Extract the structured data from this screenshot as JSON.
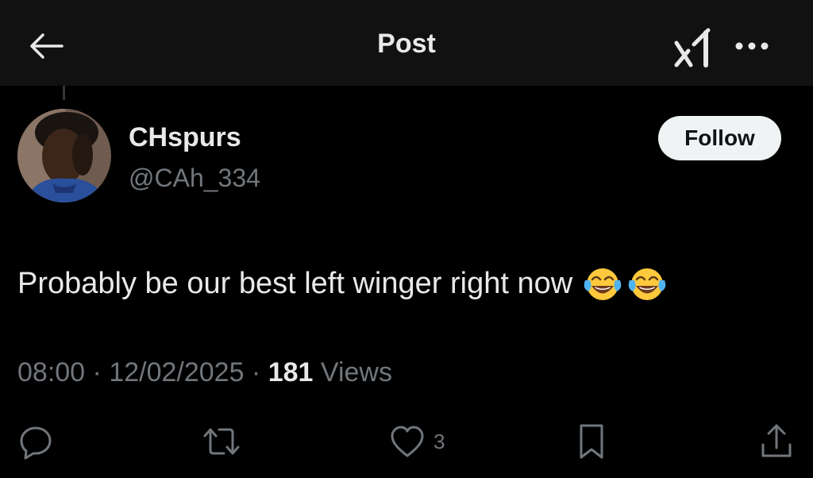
{
  "header": {
    "title": "Post",
    "back_icon": "arrow-left-icon",
    "grok_icon": "grok-icon",
    "more_icon": "more-horizontal-icon"
  },
  "author": {
    "display_name": "CHspurs",
    "handle": "@CAh_334",
    "follow_label": "Follow"
  },
  "post": {
    "text": "Probably be our best left winger right now",
    "emojis": [
      "😂",
      "😂"
    ]
  },
  "meta": {
    "time": "08:00",
    "sep1": " · ",
    "date": "12/02/2025",
    "sep2": " · ",
    "views_count": "181",
    "views_label": " Views"
  },
  "actions": {
    "reply_icon": "reply-icon",
    "repost_icon": "repost-icon",
    "like_icon": "heart-icon",
    "like_count": "3",
    "bookmark_icon": "bookmark-icon",
    "share_icon": "share-icon"
  },
  "colors": {
    "background": "#000000",
    "header_background": "#111111",
    "primary_text": "#e7e9ea",
    "secondary_text": "#71767b",
    "follow_button_bg": "#eff3f4"
  }
}
